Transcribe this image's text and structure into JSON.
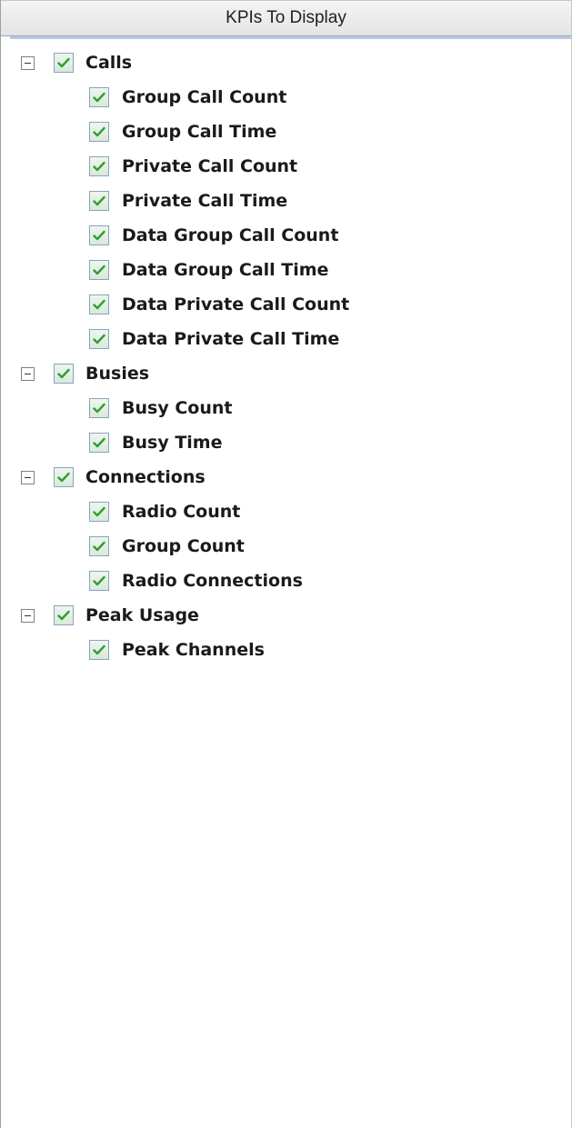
{
  "panel": {
    "title": "KPIs To Display"
  },
  "colors": {
    "check_mark": "#2f9e34",
    "checkbox_border": "#8aa2c2",
    "header_accent": "#b9c9e3"
  },
  "tree": {
    "groups": [
      {
        "label": "Calls",
        "checked": true,
        "expanded": true,
        "items": [
          {
            "label": "Group Call Count",
            "checked": true
          },
          {
            "label": "Group Call Time",
            "checked": true
          },
          {
            "label": "Private Call Count",
            "checked": true
          },
          {
            "label": "Private Call Time",
            "checked": true
          },
          {
            "label": "Data Group Call Count",
            "checked": true
          },
          {
            "label": "Data Group Call Time",
            "checked": true
          },
          {
            "label": "Data Private Call Count",
            "checked": true
          },
          {
            "label": "Data Private Call Time",
            "checked": true
          }
        ]
      },
      {
        "label": "Busies",
        "checked": true,
        "expanded": true,
        "items": [
          {
            "label": "Busy Count",
            "checked": true
          },
          {
            "label": "Busy Time",
            "checked": true
          }
        ]
      },
      {
        "label": "Connections",
        "checked": true,
        "expanded": true,
        "items": [
          {
            "label": "Radio Count",
            "checked": true
          },
          {
            "label": "Group Count",
            "checked": true
          },
          {
            "label": "Radio Connections",
            "checked": true
          }
        ]
      },
      {
        "label": "Peak Usage",
        "checked": true,
        "expanded": true,
        "items": [
          {
            "label": "Peak Channels",
            "checked": true
          }
        ]
      }
    ]
  }
}
